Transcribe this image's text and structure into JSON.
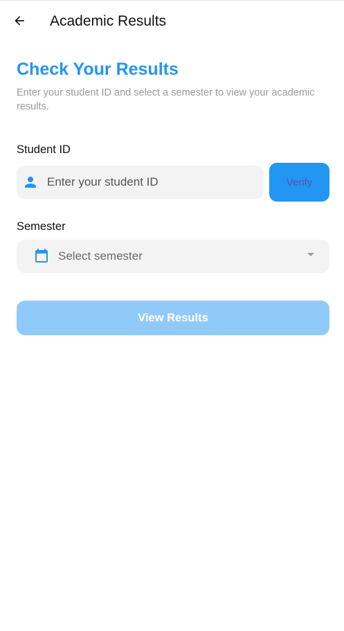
{
  "app_bar": {
    "title": "Academic Results",
    "back_icon": "arrow-left-icon"
  },
  "main": {
    "heading": "Check Your Results",
    "subtitle": "Enter your student ID and select a semester to view your academic results."
  },
  "student_id": {
    "label": "Student ID",
    "icon": "person-icon",
    "value": "",
    "placeholder": "Enter your student ID",
    "verify_label": "Verify"
  },
  "semester": {
    "label": "Semester",
    "icon": "calendar-icon",
    "selected": "Select semester",
    "dropdown_icon": "caret-down-icon"
  },
  "actions": {
    "view_results_label": "View Results"
  },
  "colors": {
    "accent": "#2196f3",
    "button_disabled": "#90caf9",
    "field_bg": "#f3f3f3"
  }
}
